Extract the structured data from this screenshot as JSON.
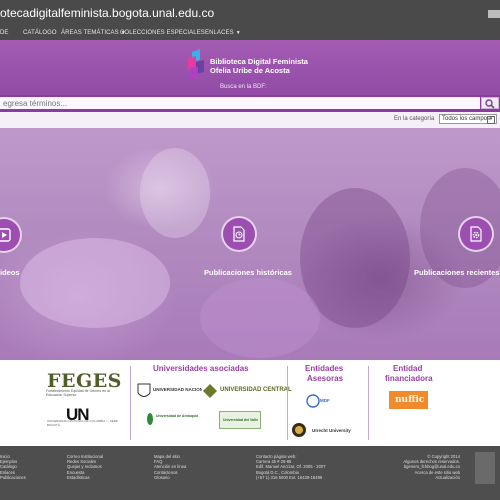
{
  "site": {
    "url_text": "otecadigitalfeminista.bogota.unal.edu.co"
  },
  "topnav": {
    "items": [
      "DE",
      "CATÁLOGO",
      "ÁREAS TEMÁTICAS",
      "COLECCIONES ESPECIALES",
      "ENLACES"
    ],
    "dropdown_indicators": [
      "▼",
      "▼"
    ]
  },
  "header": {
    "title_line1": "Biblioteca Digital Feminista",
    "title_line2": "Ofelia Uribe de Acosta",
    "search_caption": "Busca en la BDF:"
  },
  "search": {
    "placeholder": "egresa términos..."
  },
  "category": {
    "label": "En la categoría",
    "selected": "Todos los campos"
  },
  "hero": {
    "items": [
      {
        "label": "ideos",
        "icon": "video-icon"
      },
      {
        "label": "Publicaciones históricas",
        "icon": "clock-document-icon"
      },
      {
        "label": "Publicaciones recientes e",
        "icon": "gear-document-icon"
      }
    ]
  },
  "partners": {
    "feges": "FEGES",
    "feges_sub": "Fortalecimiento Equidad de Género en la Educación Superior",
    "un": "UN",
    "un_sub": "UNIVERSIDAD NACIONAL DE COLOMBIA — SEDE BOGOTÁ",
    "universidades_title": "Universidades asociadas",
    "uni_logos": [
      "UNIVERSIDAD NACIONAL DE COLOMBIA",
      "UNIVERSIDAD CENTRAL",
      "Universidad de Antioquia",
      "Universidad del Valle"
    ],
    "entidades_title_1": "Entidades",
    "entidades_title_2": "Asesoras",
    "asesoras": [
      "MDF",
      "Utrecht University"
    ],
    "financiadora_title_1": "Entidad",
    "financiadora_title_2": "financiadora",
    "financiadora": "nuffic"
  },
  "footer": {
    "col1": [
      "Inicio",
      "Ejemplos",
      "Catálogo",
      "Enlaces",
      "Publicaciones"
    ],
    "col2": [
      "Correo Institucional",
      "Redes Sociales",
      "Quejas y reclamos",
      "Encuesta",
      "Estadísticas"
    ],
    "col3": [
      "Mapa del sitio",
      "FAQ",
      "Atención en línea",
      "Contáctenos",
      "Glosario"
    ],
    "col4": [
      "Contacto página web:",
      "Carrera 45 # 26-85",
      "Edif. Manuel Ancízar, Of. 2005 - 2007",
      "Bogotá D.C., Colombia",
      "(+57 1) 316 5000 Ext. 16439-16499"
    ],
    "col5": [
      "© Copyright 2014",
      "Algunos derechos reservados.",
      "bgenero_fchbog@unal.edu.co",
      "Acerca de este sitio web",
      "Actualización"
    ]
  },
  "colors": {
    "header_purple": "#8c46a2",
    "accent_purple": "#9a3fa4",
    "footer_gray": "#4e4e4e"
  }
}
